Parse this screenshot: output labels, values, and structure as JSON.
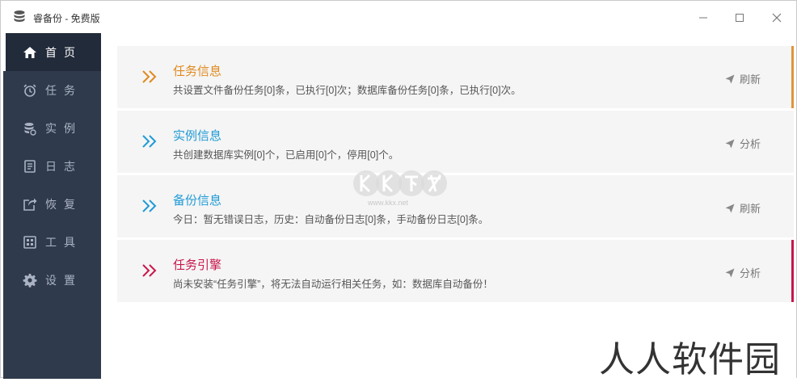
{
  "window": {
    "title": "睿备份 - 免费版"
  },
  "sidebar": {
    "items": [
      {
        "label": "首页",
        "icon": "home-icon",
        "active": true
      },
      {
        "label": "任务",
        "icon": "alarm-clock-icon",
        "active": false
      },
      {
        "label": "实例",
        "icon": "database-icon",
        "active": false
      },
      {
        "label": "日志",
        "icon": "document-icon",
        "active": false
      },
      {
        "label": "恢复",
        "icon": "share-export-icon",
        "active": false
      },
      {
        "label": "工具",
        "icon": "calculator-icon",
        "active": false
      },
      {
        "label": "设置",
        "icon": "gear-icon",
        "active": false
      }
    ]
  },
  "cards": [
    {
      "title": "任务信息",
      "desc": "共设置文件备份任务[0]条，已执行[0]次；数据库备份任务[0]条，已执行[0]次。",
      "action": "刷新",
      "color": "#e08a1e",
      "accent": "#e0953a"
    },
    {
      "title": "实例信息",
      "desc": "共创建数据库实例[0]个，已启用[0]个，停用[0]个。",
      "action": "分析",
      "color": "#1f9bd6",
      "accent": ""
    },
    {
      "title": "备份信息",
      "desc": "今日：暂无错误日志，历史：自动备份日志[0]条，手动备份日志[0]条。",
      "action": "刷新",
      "color": "#1f9bd6",
      "accent": ""
    },
    {
      "title": "任务引擎",
      "desc": "尚未安装“任务引擎”，将无法自动运行相关任务，如：数据库自动备份！",
      "action": "分析",
      "color": "#c8174c",
      "accent": "#c8174c"
    }
  ],
  "watermark": {
    "logo": "KK下载",
    "site_text": "人人软件园"
  }
}
